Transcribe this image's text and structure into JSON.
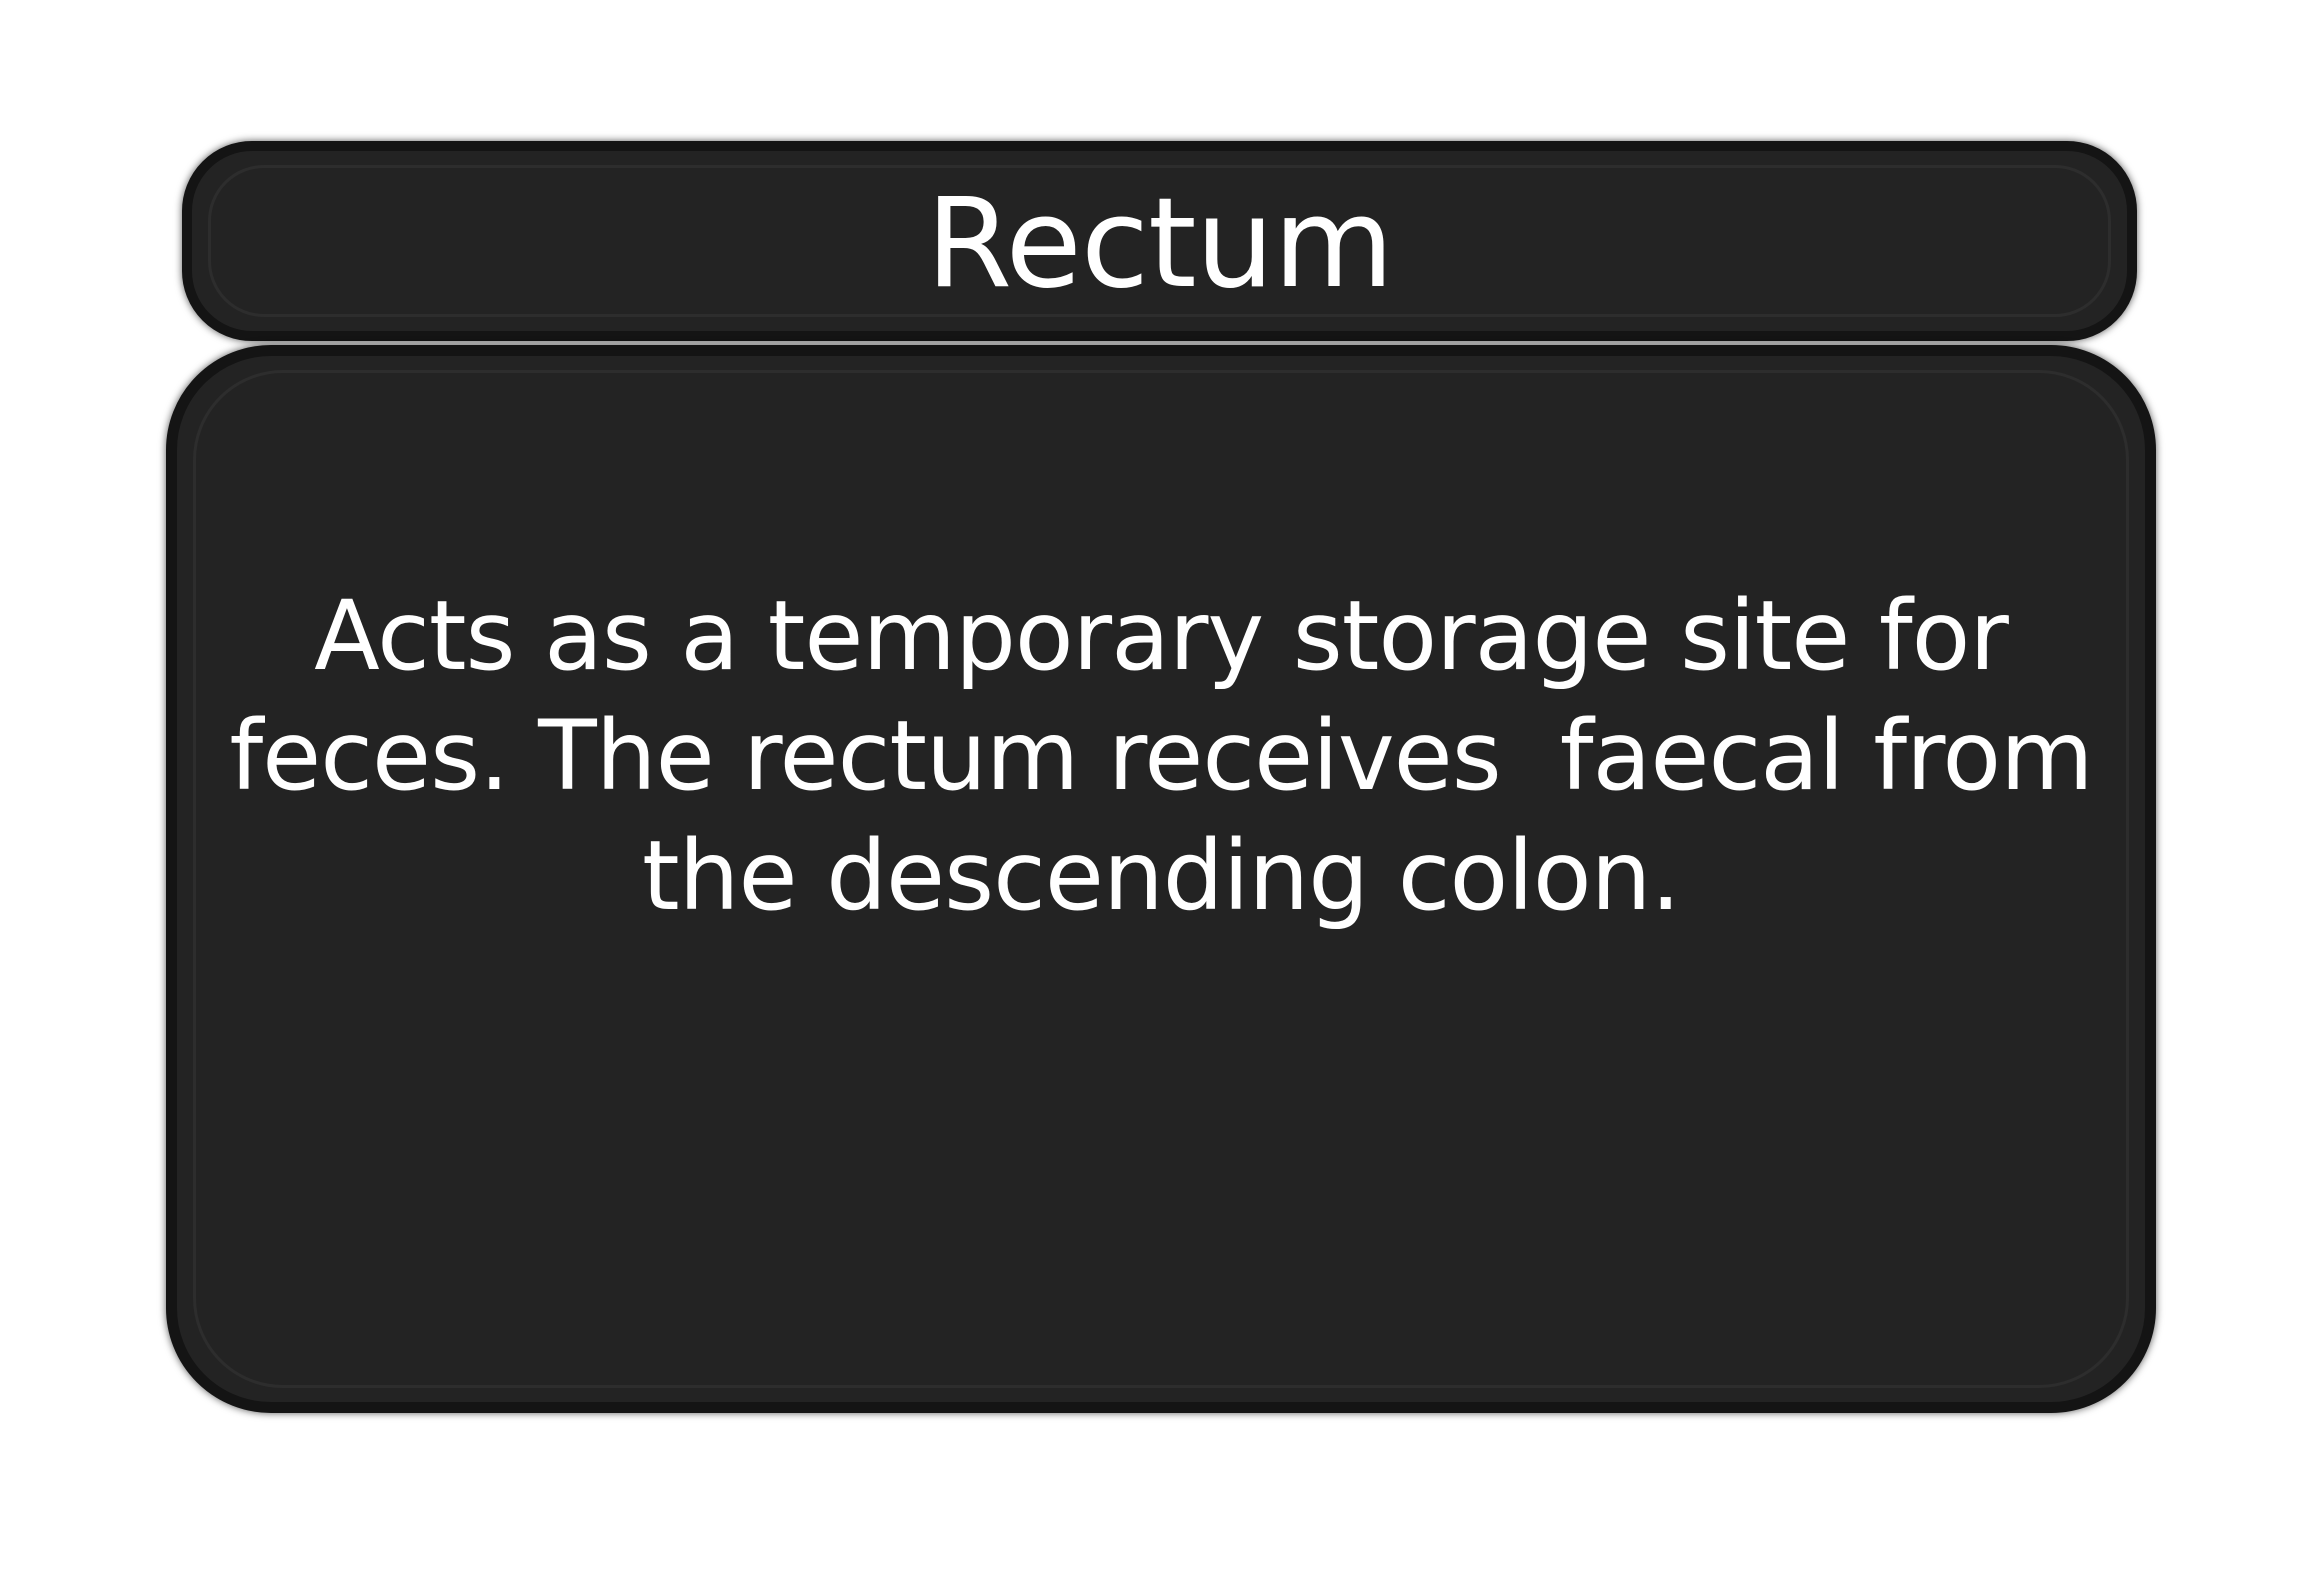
{
  "card": {
    "title": "Rectum",
    "description": "Acts as a temporary storage site for\nfeces. The rectum receives  faecal from\nthe descending colon."
  }
}
